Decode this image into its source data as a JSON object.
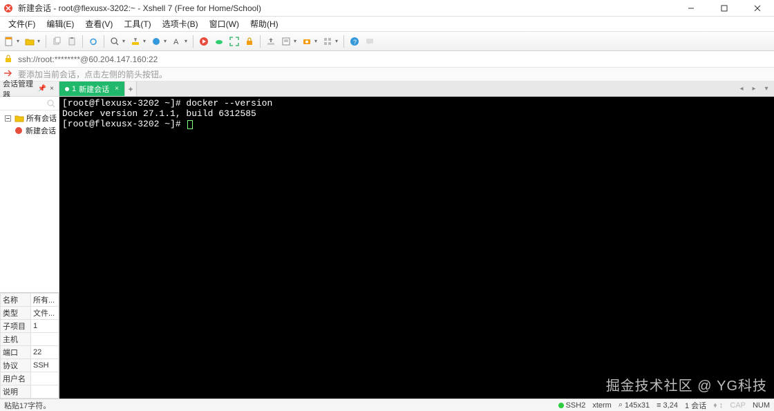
{
  "titlebar": {
    "title": "新建会话 - root@flexusx-3202:~ - Xshell 7 (Free for Home/School)"
  },
  "menubar": {
    "items": [
      "文件(F)",
      "编辑(E)",
      "查看(V)",
      "工具(T)",
      "选项卡(B)",
      "窗口(W)",
      "帮助(H)"
    ]
  },
  "addressbar": {
    "text": "ssh://root:********@60.204.147.160:22"
  },
  "hintbar": {
    "text": "要添加当前会话，点击左侧的箭头按钮。"
  },
  "session_mgr": {
    "title": "会话管理器"
  },
  "tabs": {
    "active": {
      "num": "1",
      "label": "新建会话"
    }
  },
  "tree": {
    "root": "所有会话",
    "child": "新建会话"
  },
  "properties": {
    "rows": [
      {
        "k": "名称",
        "v": "所有..."
      },
      {
        "k": "类型",
        "v": "文件..."
      },
      {
        "k": "子项目",
        "v": "1"
      },
      {
        "k": "主机",
        "v": ""
      },
      {
        "k": "端口",
        "v": "22"
      },
      {
        "k": "协议",
        "v": "SSH"
      },
      {
        "k": "用户名",
        "v": ""
      },
      {
        "k": "说明",
        "v": ""
      }
    ]
  },
  "terminal": {
    "lines": [
      "[root@flexusx-3202 ~]# docker --version",
      "Docker version 27.1.1, build 6312585",
      "[root@flexusx-3202 ~]# "
    ]
  },
  "watermark": "掘金技术社区 @ YG科技",
  "statusbar": {
    "left": "粘贴17字符。",
    "ssh": "SSH2",
    "term": "xterm",
    "size": "145x31",
    "pos": "3,24",
    "sessions": "1 会话",
    "cap": "CAP",
    "num": "NUM"
  }
}
